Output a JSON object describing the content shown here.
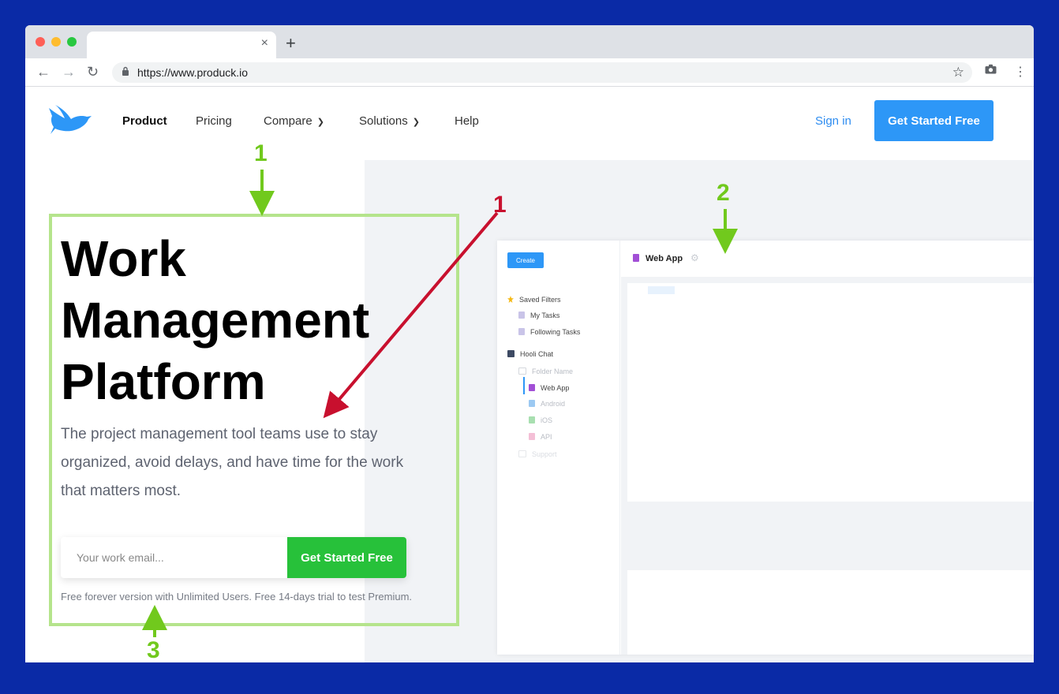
{
  "browser": {
    "url": "https://www.produck.io",
    "new_tab_glyph": "+",
    "close_glyph": "×"
  },
  "nav": {
    "items": [
      "Product",
      "Pricing",
      "Compare",
      "Solutions",
      "Help"
    ],
    "sign_in": "Sign in",
    "cta": "Get Started Free"
  },
  "hero": {
    "title_lines": [
      "Work",
      "Management",
      "Platform"
    ],
    "subtitle": "The project management tool teams use to stay organized, avoid delays, and have time for the work that matters most.",
    "email_placeholder": "Your work email...",
    "cta": "Get Started Free",
    "note": "Free forever version with Unlimited Users. Free 14-days trial to test Premium."
  },
  "app_preview": {
    "create_label": "Create",
    "header_title": "Web App",
    "sidebar": {
      "saved_filters": "Saved Filters",
      "my_tasks": "My Tasks",
      "following_tasks": "Following Tasks",
      "workspace": "Hooli Chat",
      "folder": "Folder Name",
      "projects": [
        "Web App",
        "Android",
        "iOS",
        "API"
      ],
      "support": "Support"
    }
  },
  "annotations": {
    "labels": [
      "1",
      "1",
      "2",
      "3"
    ],
    "colors": {
      "green": "#71c91d",
      "red": "#c8102e",
      "box": "#b5e48c"
    }
  },
  "colors": {
    "frame": "#0a2aa6",
    "primary_blue": "#2d97f7",
    "green_cta": "#27c13a"
  },
  "icons": [
    "back-arrow-icon",
    "forward-arrow-icon",
    "reload-icon",
    "lock-icon",
    "star-icon",
    "camera-icon",
    "menu-dots-icon",
    "bird-logo-icon",
    "chevron-down-icon",
    "gear-icon"
  ]
}
